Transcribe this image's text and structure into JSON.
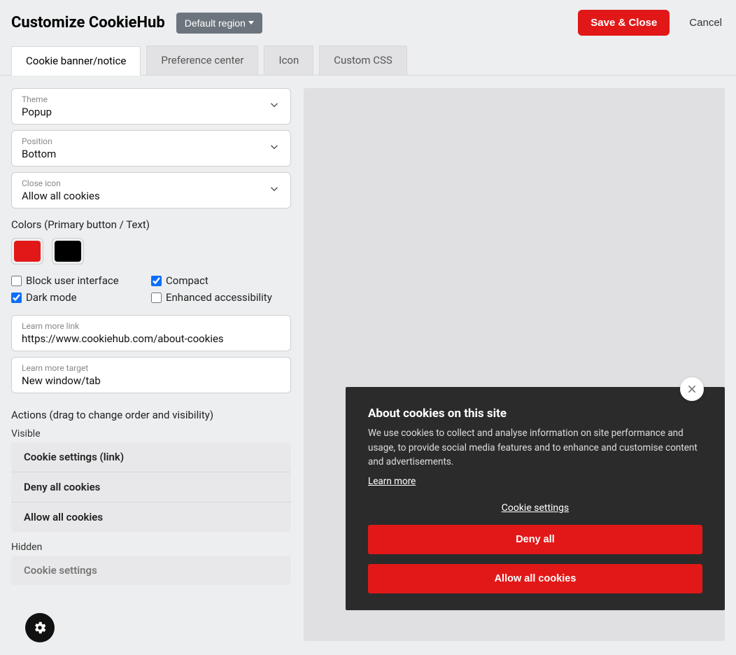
{
  "header": {
    "title": "Customize CookieHub",
    "region": "Default region",
    "save": "Save & Close",
    "cancel": "Cancel"
  },
  "tabs": {
    "banner": "Cookie banner/notice",
    "pref": "Preference center",
    "icon": "Icon",
    "css": "Custom CSS"
  },
  "fields": {
    "theme": {
      "label": "Theme",
      "value": "Popup"
    },
    "position": {
      "label": "Position",
      "value": "Bottom"
    },
    "closeicon": {
      "label": "Close icon",
      "value": "Allow all cookies"
    },
    "learnlink": {
      "label": "Learn more link",
      "value": "https://www.cookiehub.com/about-cookies"
    },
    "learntarget": {
      "label": "Learn more target",
      "value": "New window/tab"
    }
  },
  "colors": {
    "heading": "Colors (Primary button / Text)",
    "primary": "#e21818",
    "text": "#000000"
  },
  "checks": {
    "blockui": "Block user interface",
    "compact": "Compact",
    "darkmode": "Dark mode",
    "accessibility": "Enhanced accessibility"
  },
  "actions": {
    "heading": "Actions (drag to change order and visibility)",
    "visible_label": "Visible",
    "hidden_label": "Hidden",
    "visible": [
      "Cookie settings (link)",
      "Deny all cookies",
      "Allow all cookies"
    ],
    "hidden": [
      "Cookie settings"
    ]
  },
  "preview": {
    "title": "About cookies on this site",
    "desc": "We use cookies to collect and analyse information on site performance and usage, to provide social media features and to enhance and customise content and advertisements.",
    "learn": "Learn more",
    "settings": "Cookie settings",
    "deny": "Deny all",
    "allow": "Allow all cookies"
  }
}
